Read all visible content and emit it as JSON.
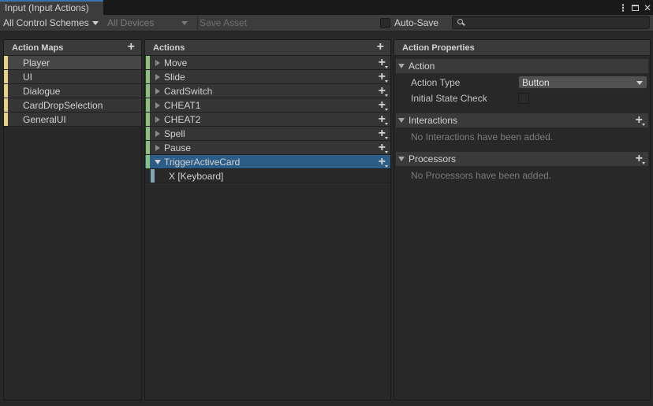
{
  "window": {
    "tab_title": "Input (Input Actions)"
  },
  "toolbar": {
    "control_schemes": "All Control Schemes",
    "devices": "All Devices",
    "save_asset": "Save Asset",
    "auto_save": "Auto-Save",
    "search_value": ""
  },
  "action_maps": {
    "header": "Action Maps",
    "items": [
      {
        "label": "Player",
        "selected": true
      },
      {
        "label": "UI"
      },
      {
        "label": "Dialogue"
      },
      {
        "label": "CardDropSelection"
      },
      {
        "label": "GeneralUI"
      }
    ]
  },
  "actions": {
    "header": "Actions",
    "items": [
      {
        "label": "Move"
      },
      {
        "label": "Slide"
      },
      {
        "label": "CardSwitch"
      },
      {
        "label": "CHEAT1"
      },
      {
        "label": "CHEAT2"
      },
      {
        "label": "Spell"
      },
      {
        "label": "Pause"
      },
      {
        "label": "TriggerActiveCard",
        "selected": true,
        "expanded": true
      }
    ],
    "binding": "X [Keyboard]"
  },
  "properties": {
    "header": "Action Properties",
    "action_section": "Action",
    "action_type_label": "Action Type",
    "action_type_value": "Button",
    "initial_state_label": "Initial State Check",
    "interactions_section": "Interactions",
    "interactions_empty": "No Interactions have been added.",
    "processors_section": "Processors",
    "processors_empty": "No Processors have been added."
  },
  "colors": {
    "map_bar": "#e6d184",
    "action_bar": "#89c27e",
    "binding_bar": "#7fa6b4",
    "selection": "#2c5d87"
  }
}
